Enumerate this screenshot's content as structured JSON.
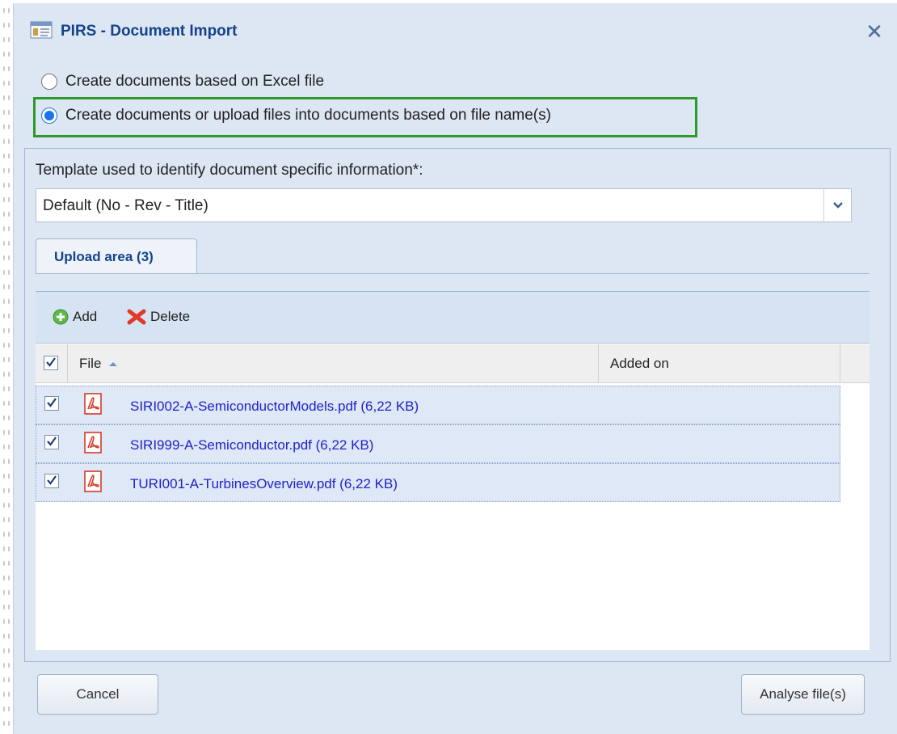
{
  "dialog": {
    "title": "PIRS - Document Import",
    "close_icon": "close-icon"
  },
  "import_mode": {
    "options": [
      {
        "label": "Create documents based on Excel file",
        "selected": false
      },
      {
        "label": "Create documents or upload files into documents based on file name(s)",
        "selected": true
      }
    ]
  },
  "template": {
    "label": "Template used to identify document specific information*:",
    "value": "Default (No - Rev - Title)"
  },
  "tabs": [
    {
      "label": "Upload area (3)",
      "active": true
    }
  ],
  "toolbar": {
    "add_label": "Add",
    "delete_label": "Delete"
  },
  "grid": {
    "columns": [
      "File",
      "Added on"
    ],
    "sort_column": "File",
    "sort_direction": "ascending",
    "rows": [
      {
        "file": "SIRI002-A-SemiconductorModels.pdf (6,22 KB)",
        "added_on": "",
        "checked": true
      },
      {
        "file": "SIRI999-A-Semiconductor.pdf (6,22 KB)",
        "added_on": "",
        "checked": true
      },
      {
        "file": "TURI001-A-TurbinesOverview.pdf (6,22 KB)",
        "added_on": "",
        "checked": true
      }
    ]
  },
  "buttons": {
    "cancel": "Cancel",
    "analyse": "Analyse file(s)"
  },
  "colors": {
    "dialog_bg": "#dde6f3",
    "title": "#15428b",
    "highlight": "#2b9a2b",
    "link": "#1f22c8",
    "radio_selected": "#1a73e8"
  }
}
